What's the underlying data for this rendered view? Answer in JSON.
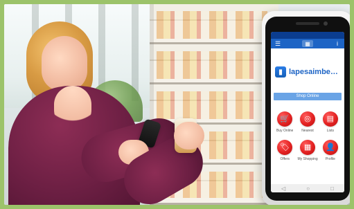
{
  "phone": {
    "statusbar": {
      "left": "",
      "right": ""
    },
    "appbar": {
      "menu_icon": "☰",
      "center_icon": "▦",
      "info_icon": "i"
    },
    "brand": {
      "mark": "▮",
      "name": "lapesaimbengila"
    },
    "cta_label": "Shop Online",
    "grid": [
      {
        "icon_name": "cart-icon",
        "icon": "🛒",
        "label": "Buy Online"
      },
      {
        "icon_name": "target-icon",
        "icon": "◎",
        "label": "Nearest"
      },
      {
        "icon_name": "list-icon",
        "icon": "▤",
        "label": "Lists"
      },
      {
        "icon_name": "tag-icon",
        "icon": "🏷",
        "label": "Offers"
      },
      {
        "icon_name": "grid-icon",
        "icon": "▦",
        "label": "My Shopping"
      },
      {
        "icon_name": "user-icon",
        "icon": "👤",
        "label": "Profile"
      }
    ],
    "navbar": {
      "back": "◁",
      "home": "○",
      "recent": "□"
    }
  }
}
